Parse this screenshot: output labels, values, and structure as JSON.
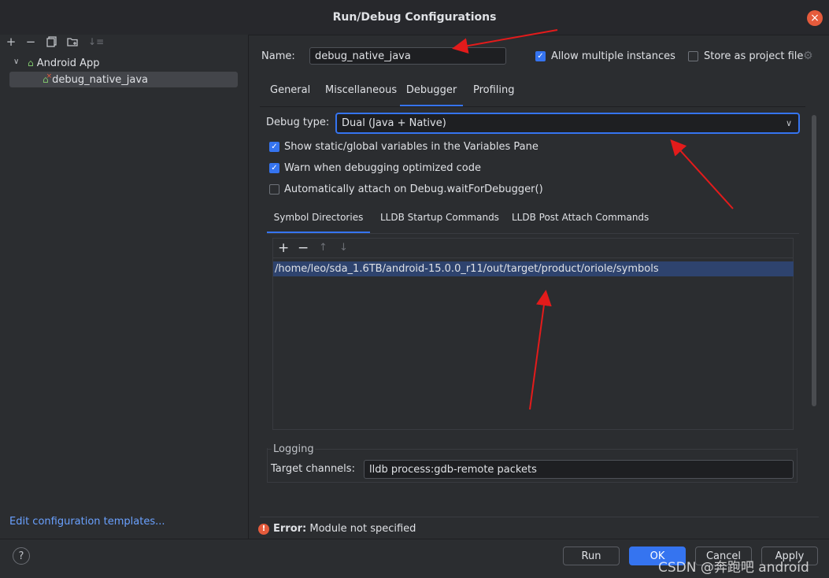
{
  "window": {
    "title": "Run/Debug Configurations"
  },
  "left": {
    "tree": {
      "group_label": "Android App",
      "config_label": "debug_native_java"
    },
    "edit_templates_link": "Edit configuration templates..."
  },
  "form": {
    "name_label": "Name:",
    "name_value": "debug_native_java",
    "allow_multiple_label": "Allow multiple instances",
    "allow_multiple_checked": true,
    "store_project_label": "Store as project file",
    "store_project_checked": false
  },
  "tabs": [
    "General",
    "Miscellaneous",
    "Debugger",
    "Profiling"
  ],
  "active_tab": "Debugger",
  "debugger": {
    "debug_type_label": "Debug type:",
    "debug_type_value": "Dual (Java + Native)",
    "options": [
      {
        "label": "Show static/global variables in the Variables Pane",
        "checked": true
      },
      {
        "label": "Warn when debugging optimized code",
        "checked": true
      },
      {
        "label": "Automatically attach on Debug.waitForDebugger()",
        "checked": false
      }
    ],
    "subtabs": [
      "Symbol Directories",
      "LLDB Startup Commands",
      "LLDB Post Attach Commands"
    ],
    "active_subtab": "Symbol Directories",
    "symbol_directories": [
      "/home/leo/sda_1.6TB/android-15.0.0_r11/out/target/product/oriole/symbols"
    ],
    "logging": {
      "section_label": "Logging",
      "target_channels_label": "Target channels:",
      "target_channels_value": "lldb process:gdb-remote packets"
    }
  },
  "status": {
    "error_label": "Error:",
    "error_message": "Module not specified"
  },
  "buttons": {
    "run": "Run",
    "ok": "OK",
    "cancel": "Cancel",
    "apply": "Apply",
    "help": "?"
  },
  "watermark": "CSDN @奔跑吧 android",
  "colors": {
    "accent": "#3574f0",
    "background": "#2b2d30",
    "error": "#e55b3c",
    "annotation_arrow": "#e31b1b"
  },
  "icons": {
    "add": "plus-icon",
    "remove": "minus-icon",
    "copy": "copy-icon",
    "folder": "new-folder-icon",
    "sort": "sort-icon",
    "expand": "chevron-down-icon",
    "android": "android-icon",
    "settings": "gear-icon",
    "move_up": "arrow-up-icon",
    "move_down": "arrow-down-icon",
    "close": "close-icon"
  }
}
